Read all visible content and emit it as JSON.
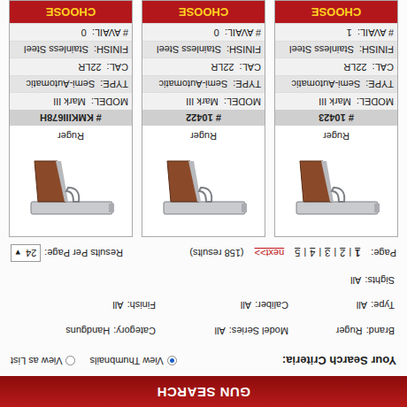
{
  "header": {
    "title": "GUN SEARCH"
  },
  "criteria": {
    "label": "Your Search Criteria:",
    "views": [
      {
        "label": "View Thumbnails",
        "selected": true
      },
      {
        "label": "View as List",
        "selected": false
      }
    ],
    "fields": [
      {
        "label": "Brand:",
        "value": "Ruger"
      },
      {
        "label": "Model Series:",
        "value": "All"
      },
      {
        "label": "Category:",
        "value": "Handguns"
      },
      {
        "label": "Type:",
        "value": "All"
      },
      {
        "label": "Caliber:",
        "value": "All"
      },
      {
        "label": "Finish:",
        "value": "All"
      },
      {
        "label": "Sights:",
        "value": "All"
      }
    ]
  },
  "pagination": {
    "label": "Page:",
    "separator": "|",
    "pages": [
      {
        "label": "1",
        "selected": true
      },
      {
        "label": "2",
        "selected": false
      },
      {
        "label": "3",
        "selected": false
      },
      {
        "label": "4",
        "selected": false
      },
      {
        "label": "5",
        "selected": false
      }
    ],
    "next": "next>>",
    "results": "(158 results)",
    "per_page_label": "Results Per Page:",
    "per_page": "24",
    "dropdown_arrow": "▾"
  },
  "products": [
    {
      "brand": "Ruger",
      "number": "# 10423",
      "button": "CHOOSE",
      "specs": [
        {
          "label": "MODEL:",
          "value": "Mark III"
        },
        {
          "label": "TYPE:",
          "value": "Semi-Automatic"
        },
        {
          "label": "CAL:",
          "value": "22LR"
        },
        {
          "label": "FINISH:",
          "value": "Stainless Steel"
        },
        {
          "label": "# AVAIL:",
          "value": "1"
        }
      ]
    },
    {
      "brand": "Ruger",
      "number": "# 10422",
      "button": "CHOOSE",
      "specs": [
        {
          "label": "MODEL:",
          "value": "Mark III"
        },
        {
          "label": "TYPE:",
          "value": "Semi-Automatic"
        },
        {
          "label": "CAL:",
          "value": "22LR"
        },
        {
          "label": "FINISH:",
          "value": "Stainless Steel"
        },
        {
          "label": "# AVAIL:",
          "value": "0"
        }
      ]
    },
    {
      "brand": "Ruger",
      "number": "# KMKIII678H",
      "button": "CHOOSE",
      "specs": [
        {
          "label": "MODEL:",
          "value": "Mark III"
        },
        {
          "label": "TYPE:",
          "value": "Semi-Automatic"
        },
        {
          "label": "CAL:",
          "value": "22LR"
        },
        {
          "label": "FINISH:",
          "value": "Stainless Steel"
        },
        {
          "label": "# AVAIL:",
          "value": "0"
        }
      ]
    }
  ]
}
